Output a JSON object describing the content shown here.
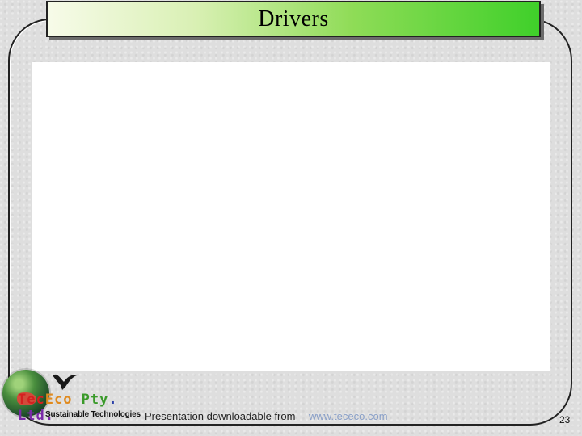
{
  "slide": {
    "title": "Drivers",
    "page_number": "23"
  },
  "logo": {
    "company_name_parts": [
      "Tec",
      "Eco",
      " Pty",
      ". ",
      "Ltd."
    ],
    "tagline": "Sustainable Technologies",
    "icons": [
      "globe-icon",
      "bird-icon"
    ]
  },
  "footer": {
    "prefix": "Presentation downloadable from ",
    "link_text": "www.tececo.com"
  },
  "colors": {
    "title_gradient_start": "#f7fbe9",
    "title_gradient_end": "#3fd02a",
    "background": "#dedede",
    "link": "#8aa0c8"
  }
}
